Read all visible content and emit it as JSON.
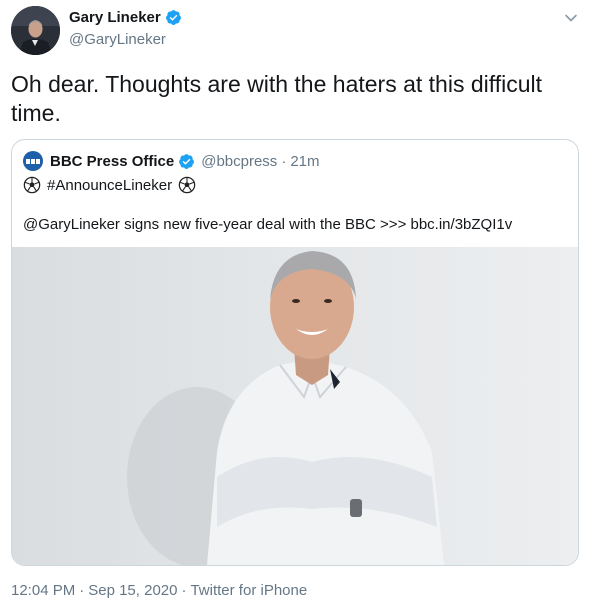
{
  "author": {
    "name": "Gary Lineker",
    "handle": "@GaryLineker"
  },
  "tweet": {
    "text": "Oh dear. Thoughts are with the haters at this difficult time."
  },
  "quoted_tweet": {
    "name": "BBC Press Office",
    "handle": "@bbcpress",
    "separator": "·",
    "time": "21m",
    "hashtag": "#AnnounceLineker",
    "body": "@GaryLineker signs new five-year deal with the BBC >>> bbc.in/3bZQI1v"
  },
  "footer": {
    "time": "12:04 PM",
    "dot1": "·",
    "date": "Sep 15, 2020",
    "dot2": "·",
    "source": "Twitter for iPhone"
  },
  "colors": {
    "verified": "#1da1f2",
    "secondary_text": "#657786",
    "bbc_blue": "#1d5fa8"
  },
  "icons": [
    "avatar",
    "verified-icon",
    "chevron-down-icon",
    "bbc-logo",
    "soccer-ball-icon"
  ]
}
